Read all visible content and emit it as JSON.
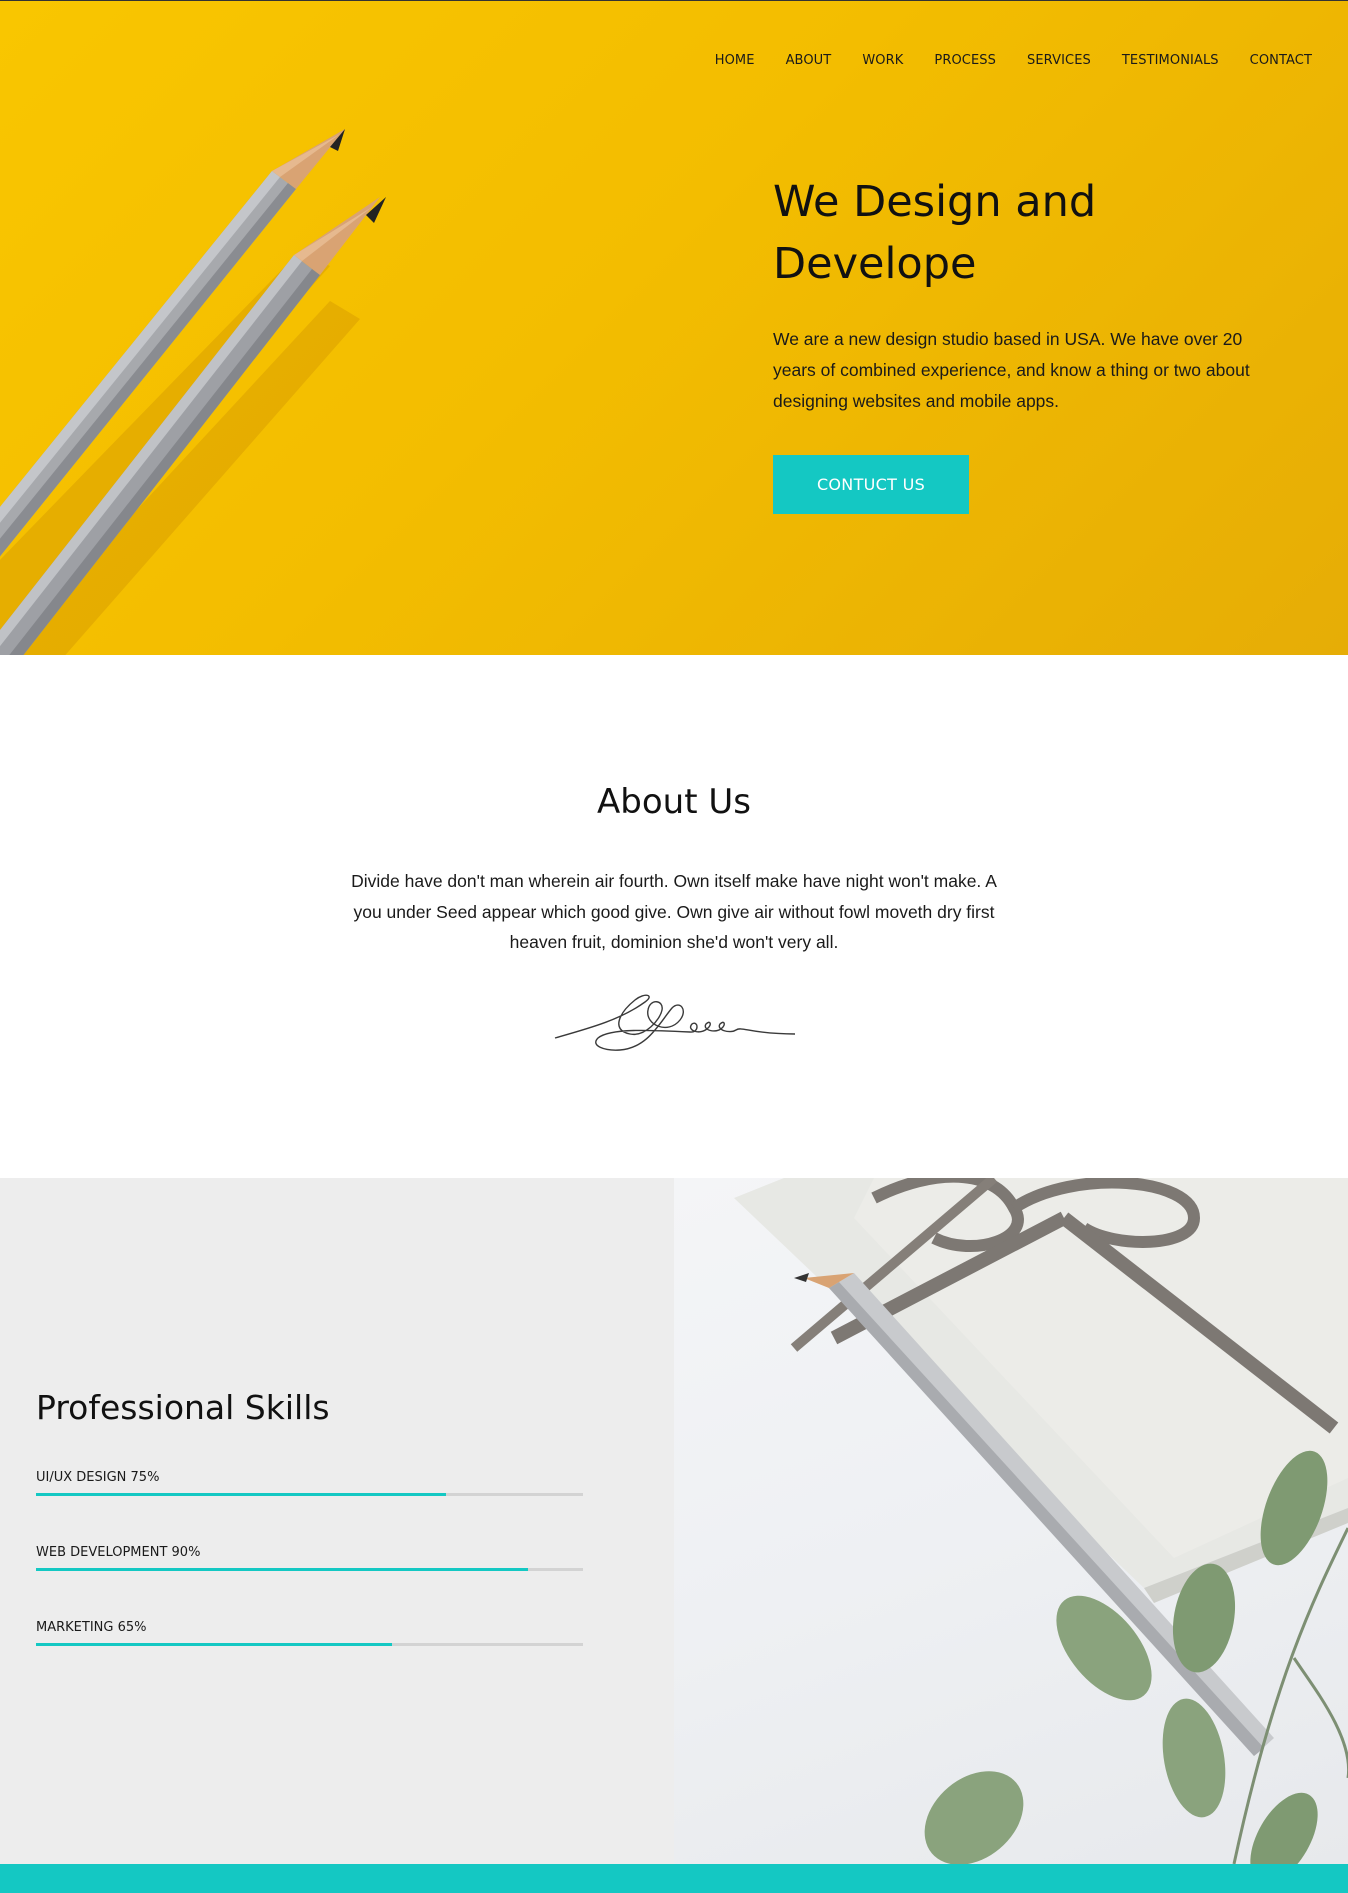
{
  "nav": {
    "items": [
      "HOME",
      "ABOUT",
      "WORK",
      "PROCESS",
      "SERVICES",
      "TESTIMONIALS",
      "CONTACT"
    ]
  },
  "hero": {
    "title": "We Design and Develope",
    "text": "We are a new design studio based in USA. We have over 20 years of combined experience, and know a thing or two about designing websites and mobile apps.",
    "button_label": "CONTUCT US",
    "background_color": "#f5c000"
  },
  "about": {
    "title": "About Us",
    "text": "Divide have don't man wherein air fourth. Own itself make have night won't make. A you under Seed appear which good give. Own give air without fowl moveth dry first heaven fruit, dominion she'd won't very all."
  },
  "skills": {
    "title": "Professional Skills",
    "items": [
      {
        "label": "UI/UX DESIGN 75%",
        "percent": 75
      },
      {
        "label": "WEB DEVELOPMENT 90%",
        "percent": 90
      },
      {
        "label": "MARKETING 65%",
        "percent": 65
      }
    ]
  },
  "colors": {
    "accent": "#14c8c3",
    "hero_yellow": "#f5c000",
    "skills_bg": "#ededed"
  },
  "icons": [
    "pencils-photo",
    "signature-image",
    "gift-pencil-photo"
  ]
}
